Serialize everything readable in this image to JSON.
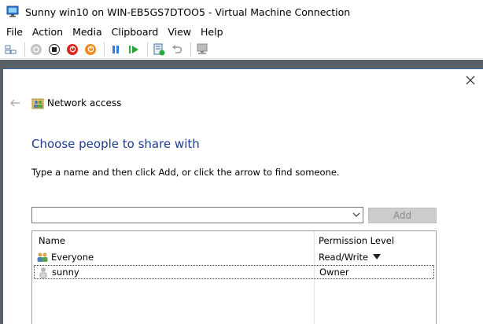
{
  "window": {
    "title": "Sunny win10 on WIN-EB5GS7DTOO5 - Virtual Machine Connection"
  },
  "menu": [
    "File",
    "Action",
    "Media",
    "Clipboard",
    "View",
    "Help"
  ],
  "toolbar": {
    "icons": [
      "ctrl-alt-del-icon",
      "start-icon",
      "turn-off-icon",
      "shut-down-icon",
      "save-icon",
      "pause-icon",
      "reset-icon",
      "checkpoint-icon",
      "revert-icon",
      "enhanced-session-icon"
    ]
  },
  "wizard": {
    "title": "Network access",
    "heading": "Choose people to share with",
    "instruction": "Type a name and then click Add, or click the arrow to find someone.",
    "combo_value": "",
    "add_label": "Add"
  },
  "table": {
    "columns": [
      "Name",
      "Permission Level"
    ],
    "rows": [
      {
        "name": "Everyone",
        "permission": "Read/Write",
        "has_dropdown": true,
        "selected": false,
        "icon": "group-users-icon"
      },
      {
        "name": "sunny",
        "permission": "Owner",
        "has_dropdown": false,
        "selected": true,
        "icon": "user-icon"
      }
    ]
  },
  "colors": {
    "heading": "#1e3d8f",
    "add_disabled_bg": "#cccccc",
    "guest_frame": "#5a6068"
  }
}
